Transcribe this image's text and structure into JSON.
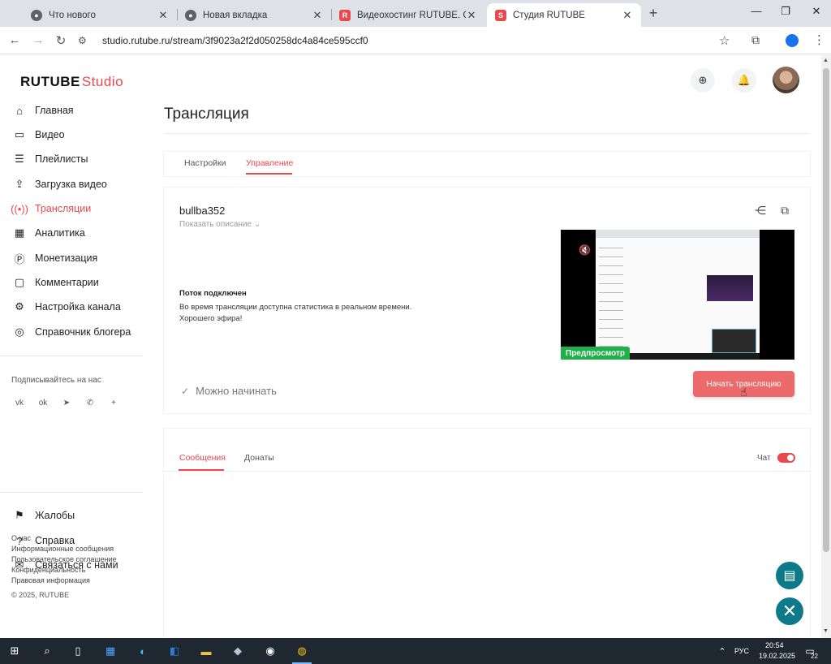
{
  "browser": {
    "tabs": [
      {
        "title": "Что нового",
        "favicon": "chrome-icon"
      },
      {
        "title": "Новая вкладка",
        "favicon": "chrome-icon"
      },
      {
        "title": "Видеохостинг RUTUBE. Смотр",
        "favicon": "rutube-icon"
      },
      {
        "title": "Студия RUTUBE",
        "favicon": "rutube-studio-icon",
        "active": true
      }
    ],
    "url": "studio.rutube.ru/stream/3f9023a2f2d050258dc4a84ce595ccf0"
  },
  "header": {
    "logo_main": "RUTUBE",
    "logo_studio": "Studio"
  },
  "sidebar": {
    "items": [
      {
        "label": "Главная",
        "icon": "home-icon"
      },
      {
        "label": "Видео",
        "icon": "video-icon"
      },
      {
        "label": "Плейлисты",
        "icon": "playlist-icon"
      },
      {
        "label": "Загрузка видео",
        "icon": "upload-icon"
      },
      {
        "label": "Трансляции",
        "icon": "broadcast-icon",
        "active": true
      },
      {
        "label": "Аналитика",
        "icon": "analytics-icon"
      },
      {
        "label": "Монетизация",
        "icon": "monetization-icon"
      },
      {
        "label": "Комментарии",
        "icon": "comments-icon"
      },
      {
        "label": "Настройка канала",
        "icon": "settings-icon"
      },
      {
        "label": "Справочник блогера",
        "icon": "handbook-icon"
      }
    ],
    "subscribe_label": "Подписывайтесь на нас",
    "socials": [
      "vk-icon",
      "ok-icon",
      "telegram-icon",
      "viber-icon",
      "plus-icon"
    ],
    "bottom_items": [
      {
        "label": "Жалобы",
        "icon": "flag-icon"
      },
      {
        "label": "Справка",
        "icon": "help-icon"
      },
      {
        "label": "Связаться с нами",
        "icon": "mail-icon"
      }
    ],
    "footer_links": [
      "О нас",
      "Информационные сообщения",
      "Пользовательское соглашение",
      "Конфиденциальность",
      "Правовая информация"
    ],
    "copyright": "© 2025, RUTUBE"
  },
  "main": {
    "title": "Трансляция",
    "tabs": [
      {
        "label": "Настройки"
      },
      {
        "label": "Управление",
        "active": true
      }
    ],
    "stream": {
      "name": "bullba352",
      "show_description": "Показать описание",
      "status_title": "Поток подключен",
      "status_line1": "Во время трансляции доступна статистика в реальном времени.",
      "status_line2": "Хорошего эфира!",
      "ready_text": "Можно начинать",
      "preview_badge": "Предпросмотр",
      "start_button": "Начать трансляцию"
    },
    "chat": {
      "tabs": [
        {
          "label": "Сообщения",
          "active": true
        },
        {
          "label": "Донаты"
        }
      ],
      "chat_label": "Чат",
      "chat_enabled": true
    }
  },
  "taskbar": {
    "lang": "РУС",
    "time": "20:54",
    "date": "19.02.2025",
    "notifications": "22"
  },
  "colors": {
    "accent": "#e8494d",
    "start_button": "#ec6a6c",
    "preview_badge": "#20b04a",
    "fab": "#0e7a89"
  }
}
